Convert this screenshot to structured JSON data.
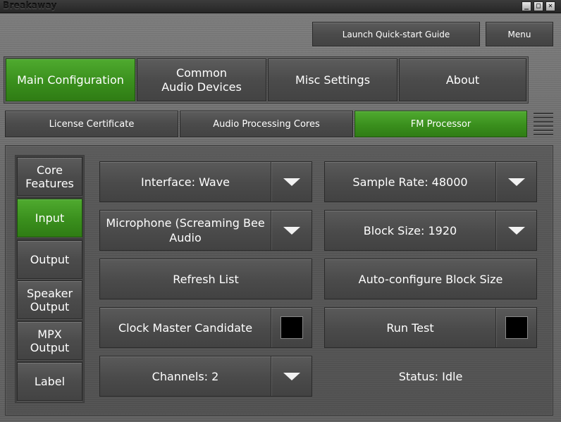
{
  "window": {
    "title": "Breakaway"
  },
  "window_controls": {
    "minimize": "_",
    "maximize": "□",
    "close": "✕"
  },
  "top_buttons": {
    "quickstart": "Launch Quick-start Guide",
    "menu": "Menu"
  },
  "main_tabs": [
    {
      "label": "Main Configuration",
      "active": true
    },
    {
      "label": "Common\nAudio Devices",
      "active": false
    },
    {
      "label": "Misc Settings",
      "active": false
    },
    {
      "label": "About",
      "active": false
    }
  ],
  "sub_tabs": [
    {
      "label": "License Certificate",
      "active": false
    },
    {
      "label": "Audio Processing Cores",
      "active": false
    },
    {
      "label": "FM Processor",
      "active": true
    }
  ],
  "side_nav": [
    {
      "label": "Core\nFeatures",
      "active": false
    },
    {
      "label": "Input",
      "active": true
    },
    {
      "label": "Output",
      "active": false
    },
    {
      "label": "Speaker\nOutput",
      "active": false
    },
    {
      "label": "MPX\nOutput",
      "active": false
    },
    {
      "label": "Label",
      "active": false
    }
  ],
  "controls": {
    "interface": "Interface: Wave",
    "sample_rate": "Sample Rate: 48000",
    "device": "Microphone (Screaming Bee\nAudio",
    "block_size": "Block Size: 1920",
    "refresh": "Refresh List",
    "auto_block": "Auto-configure Block Size",
    "clock_master": "Clock Master Candidate",
    "run_test": "Run Test",
    "channels": "Channels: 2",
    "status": "Status: Idle"
  },
  "icons": {
    "dropdown": "dropdown-triangle-icon",
    "checkbox": "checkbox-icon",
    "grip": "grip-lines-icon"
  },
  "colors": {
    "active_green": "#3a8f1d",
    "button_gray": "#4b4b4b",
    "checkbox_black": "#000000"
  }
}
